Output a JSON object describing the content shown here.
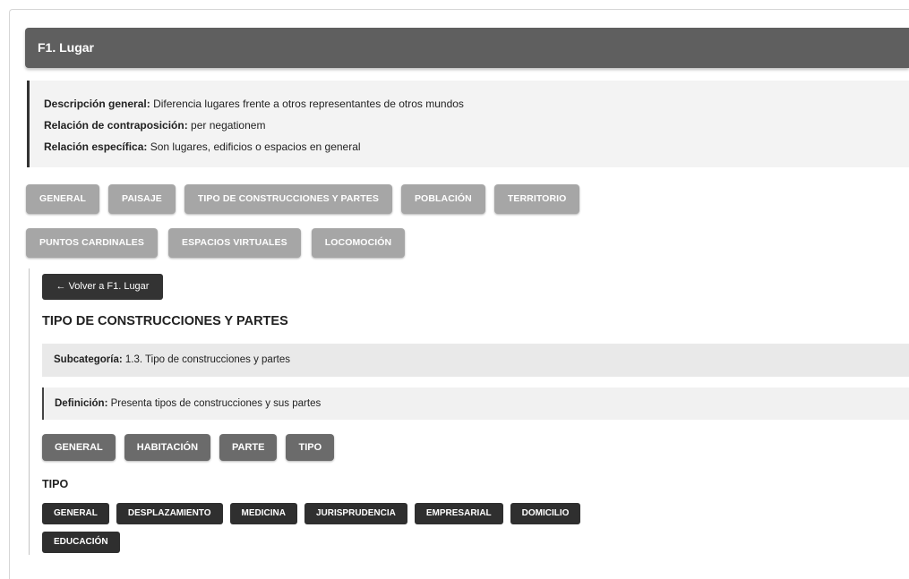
{
  "header": {
    "title": "F1. Lugar"
  },
  "description": {
    "general_label": "Descripción general:",
    "general_value": "Diferencia lugares frente a otros representantes de otros mundos",
    "contraposicion_label": "Relación de contraposición:",
    "contraposicion_value": "per negationem",
    "especifica_label": "Relación específica:",
    "especifica_value": "Son lugares, edificios o espacios en general"
  },
  "categories_row1": [
    "GENERAL",
    "PAISAJE",
    "TIPO DE CONSTRUCCIONES Y PARTES",
    "POBLACIÓN",
    "TERRITORIO"
  ],
  "categories_row2": [
    "PUNTOS CARDINALES",
    "ESPACIOS VIRTUALES",
    "LOCOMOCIÓN"
  ],
  "detail": {
    "back_label": "← Volver a F1. Lugar",
    "title": "TIPO DE CONSTRUCCIONES Y PARTES",
    "subcategory_label": "Subcategoría:",
    "subcategory_value": "1.3. Tipo de construcciones y partes",
    "definition_label": "Definición:",
    "definition_value": "Presenta tipos de construcciones y sus partes",
    "subtabs": [
      "GENERAL",
      "HABITACIÓN",
      "PARTE",
      "TIPO"
    ],
    "tipo_heading": "TIPO",
    "tipo_row1": [
      "GENERAL",
      "DESPLAZAMIENTO",
      "MEDICINA",
      "JURISPRUDENCIA",
      "EMPRESARIAL",
      "DOMICILIO"
    ],
    "tipo_row2": [
      "EDUCACIÓN"
    ]
  }
}
